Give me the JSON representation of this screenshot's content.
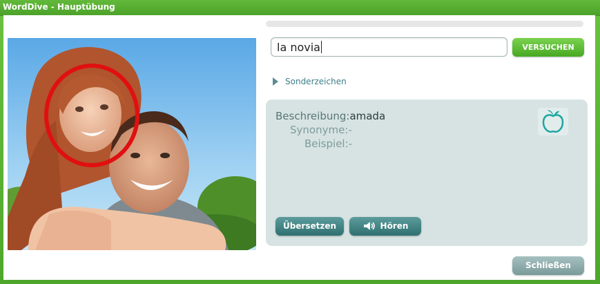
{
  "window": {
    "title": "WordDive - Hauptübung"
  },
  "exercise": {
    "progress_fraction": 0.0,
    "answer_value": "la novia",
    "try_button": "VERSUCHEN",
    "special_chars_label": "Sonderzeichen"
  },
  "info": {
    "description_label": "Beschreibung:",
    "description_value": "amada",
    "synonyms_label": "Synonyme:",
    "synonyms_value": "-",
    "example_label": "Beispiel:",
    "example_value": "-",
    "apple_icon": "apple-icon"
  },
  "actions": {
    "translate_label": "Übersetzen",
    "listen_label": "Hören",
    "close_label": "Schließen"
  },
  "colors": {
    "accent_green": "#4ea62a",
    "teal_button": "#2f6f70",
    "panel_bg": "#d7e3e3",
    "highlight_circle": "#e01010"
  }
}
